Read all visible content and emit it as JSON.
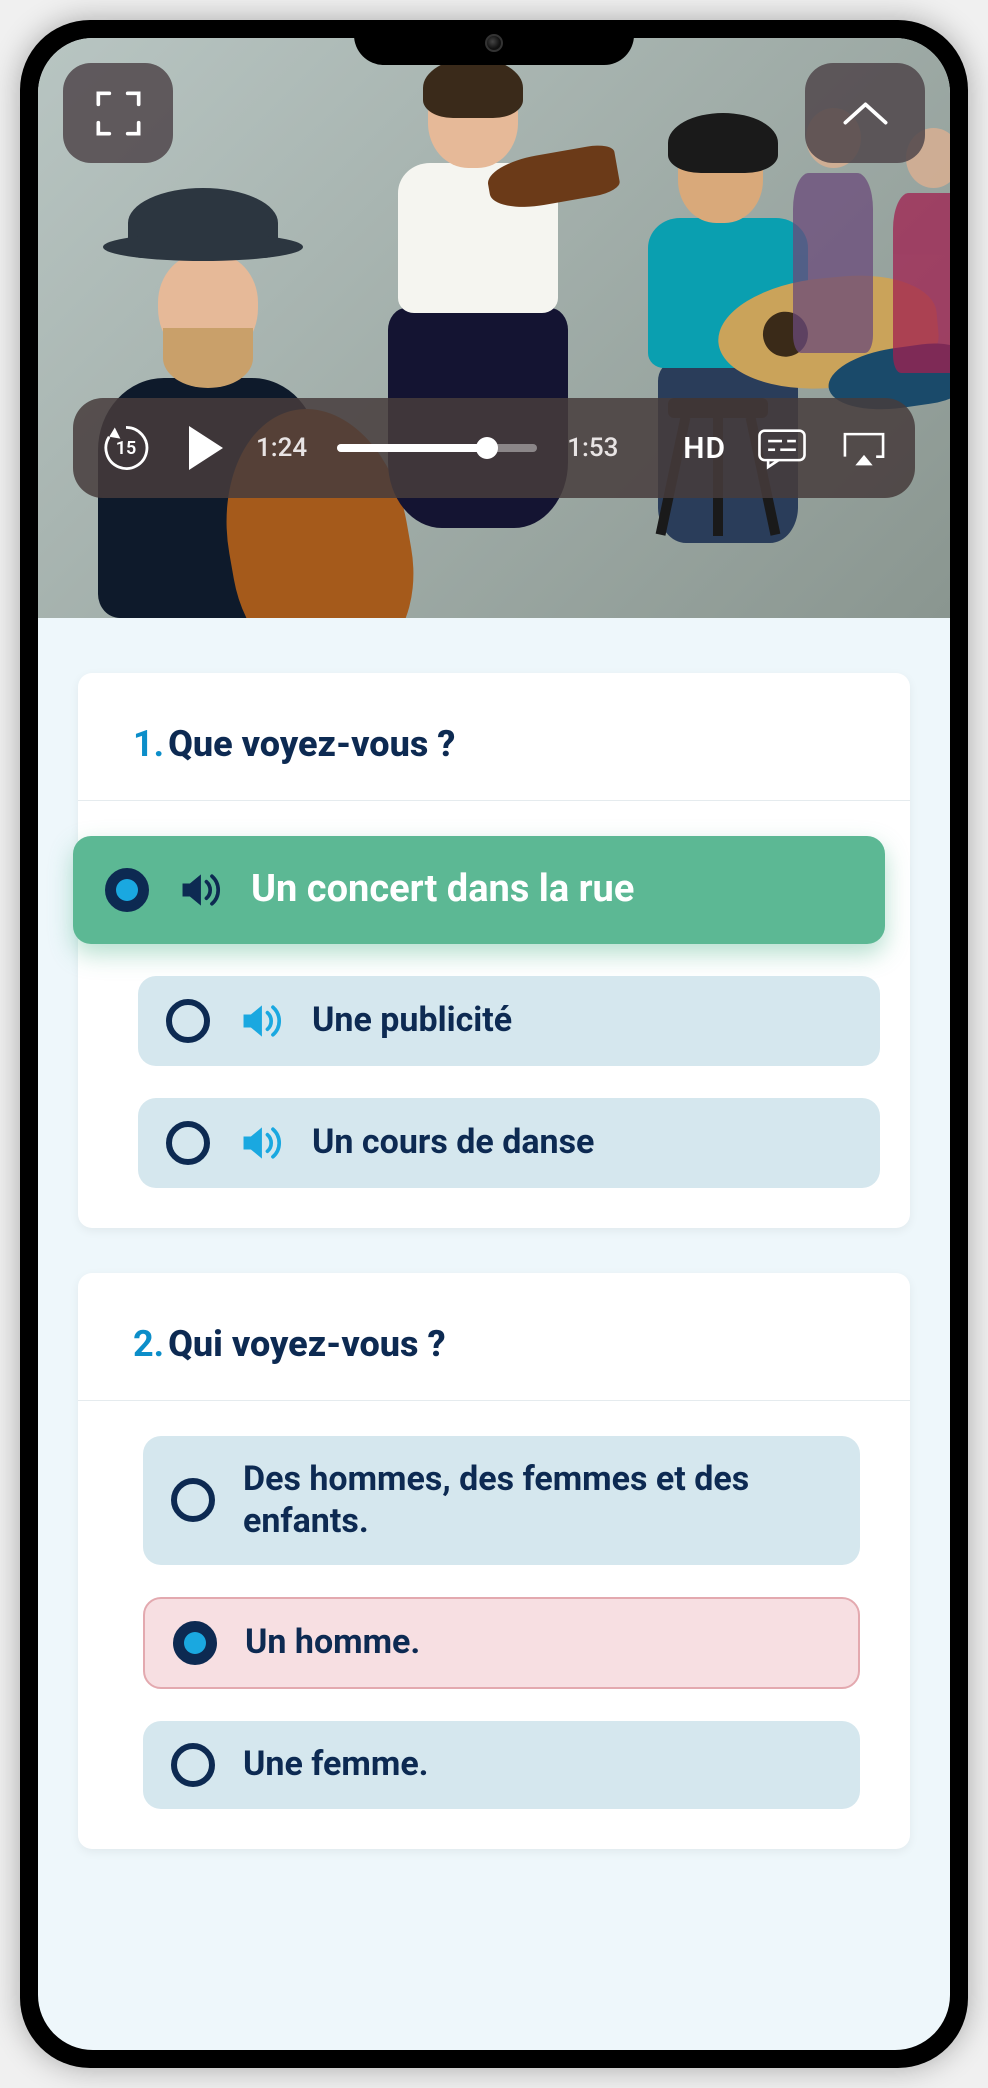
{
  "video": {
    "replay_seconds": "15",
    "time_current": "1:24",
    "time_total": "1:53",
    "hd_label": "HD",
    "progress_pct": 75
  },
  "questions": [
    {
      "number": "1.",
      "text": "Que voyez-vous ?",
      "has_audio": true,
      "options": [
        {
          "text": "Un concert dans la rue",
          "state": "correct",
          "selected": true
        },
        {
          "text": "Une publicité",
          "state": "default",
          "selected": false
        },
        {
          "text": "Un cours de danse",
          "state": "default",
          "selected": false
        }
      ]
    },
    {
      "number": "2.",
      "text": "Qui voyez-vous ?",
      "has_audio": false,
      "options": [
        {
          "text": "Des hommes, des femmes et des enfants.",
          "state": "default",
          "selected": false
        },
        {
          "text": "Un homme.",
          "state": "wrong",
          "selected": true
        },
        {
          "text": "Une femme.",
          "state": "default",
          "selected": false
        }
      ]
    }
  ],
  "colors": {
    "accent_blue": "#0c8ec9",
    "dark_navy": "#0d2a52",
    "correct_green": "#5cb894",
    "wrong_pink": "#f7dfe2",
    "option_bg": "#d5e7ee"
  }
}
